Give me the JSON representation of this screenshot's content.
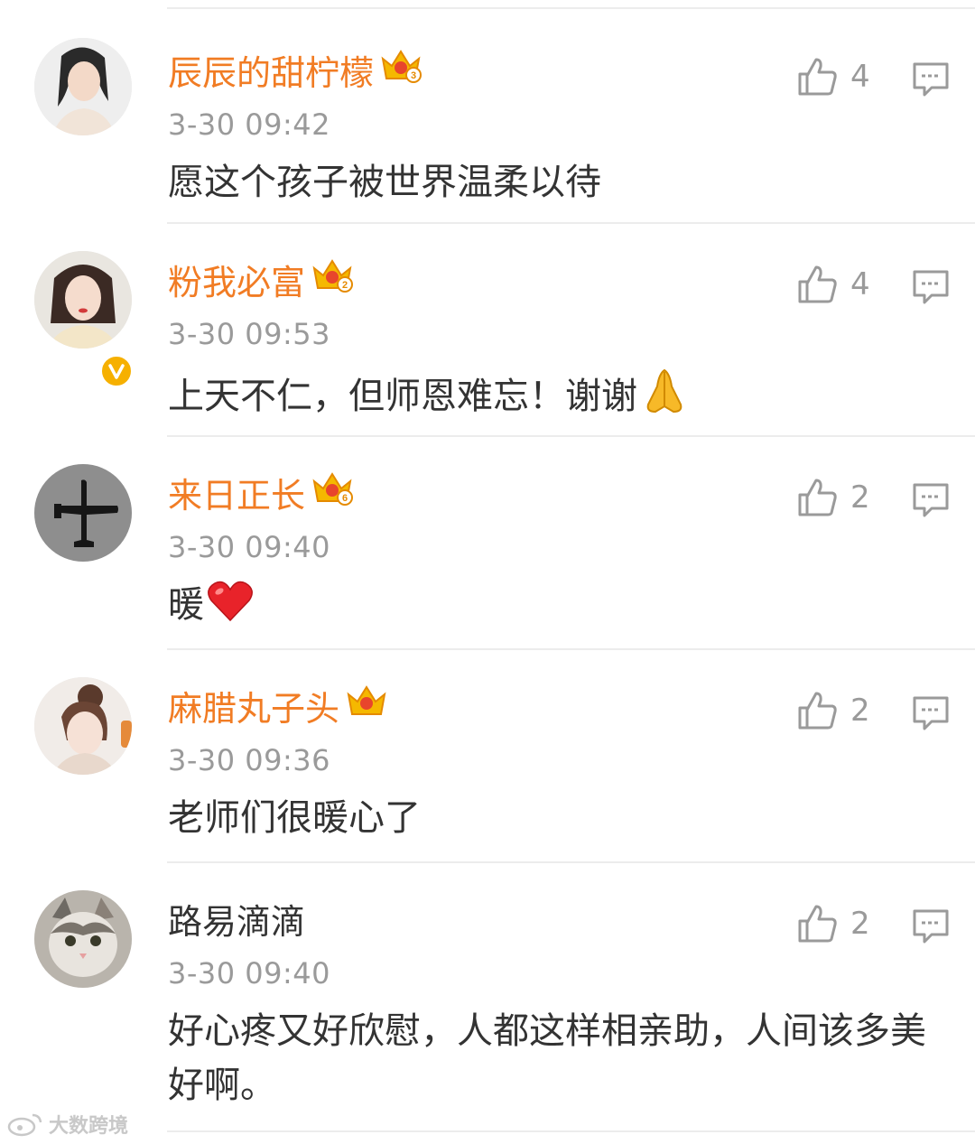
{
  "comments": [
    {
      "username": "辰辰的甜柠檬",
      "vip": true,
      "crown_level": "3",
      "verified": false,
      "time": "3-30 09:42",
      "text": "愿这个孩子被世界温柔以待",
      "emoji": "",
      "likes": "4",
      "avatar": "avatar-girl-icon"
    },
    {
      "username": "粉我必富",
      "vip": true,
      "crown_level": "2",
      "verified": true,
      "time": "3-30 09:53",
      "text": "上天不仁，但师恩难忘！谢谢",
      "emoji": "folded-hands-emoji",
      "likes": "4",
      "avatar": "avatar-woman-icon"
    },
    {
      "username": "来日正长",
      "vip": true,
      "crown_level": "6",
      "verified": false,
      "time": "3-30 09:40",
      "text": "暖",
      "emoji": "red-heart-emoji",
      "likes": "2",
      "avatar": "avatar-airplane-icon"
    },
    {
      "username": "麻腊丸子头",
      "vip": true,
      "crown_level": "",
      "verified": false,
      "time": "3-30 09:36",
      "text": "老师们很暖心了",
      "emoji": "",
      "likes": "2",
      "avatar": "avatar-bun-girl-icon"
    },
    {
      "username": "路易滴滴",
      "vip": false,
      "crown_level": "",
      "verified": false,
      "time": "3-30 09:40",
      "text": "好心疼又好欣慰，人都这样相亲助，人间该多美好啊。",
      "emoji": "",
      "likes": "2",
      "avatar": "avatar-cat-icon"
    }
  ],
  "watermark": {
    "text": "大数跨境"
  },
  "colors": {
    "vip_name": "#f17c24",
    "normal_name": "#333333",
    "meta": "#9a9a9a",
    "divider": "#ececec",
    "crown": "#f5b800"
  }
}
